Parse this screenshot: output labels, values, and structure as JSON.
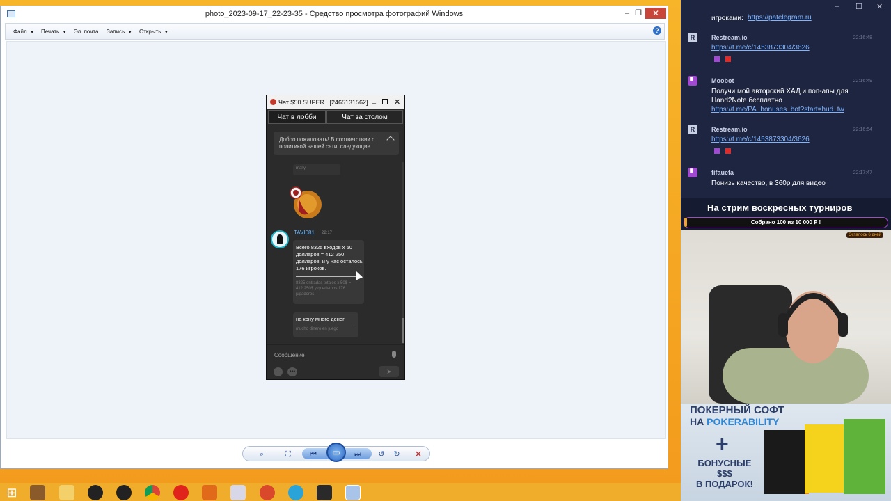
{
  "viewer": {
    "title": "photo_2023-09-17_22-23-35 - Средство просмотра фотографий Windows",
    "menu": [
      "Файл",
      "Печать",
      "Эл. почта",
      "Запись",
      "Открыть"
    ],
    "help": "?",
    "close_glyph": "✕",
    "max_glyph": "❐",
    "min_glyph": "–"
  },
  "chat": {
    "title": "Чат $50 SUPER..  [2465131562]",
    "tabs": [
      "Чат в лобби",
      "Чат за столом"
    ],
    "welcome": "Добро пожаловать! В соответствии с политикой нашей сети, следующие",
    "prev_user": "mally",
    "username": "TAVI081",
    "time": "22:17",
    "msg1": "Всего 8325 входов х 50 долларов = 412 250 долларов, и у нас осталось 176 игроков.",
    "msg1_trans": "8325 entradas totales x 50$ = 412,250$ y quedamos 176 jugadores",
    "msg2": "на кону много денег",
    "msg2_trans": "mucho dinero en juego",
    "compose_placeholder": "Сообщение"
  },
  "stream": {
    "messages": [
      {
        "name": "",
        "time": "",
        "text": "игроками: ",
        "link": "https://patelegram.ru"
      },
      {
        "name": "Restream.io",
        "time": "22:16:48",
        "text": "",
        "link": "https://t.me/c/1453873304/3626"
      },
      {
        "name": "Moobot",
        "time": "22:16:49",
        "text": "Получи мой авторский ХАД и поп-апы для Hand2Note бесплатно",
        "link": "https://t.me/PA_bonuses_bot?start=hud_tw"
      },
      {
        "name": "Restream.io",
        "time": "22:16:54",
        "text": "",
        "link": "https://t.me/c/1453873304/3626"
      },
      {
        "name": "fifauefa",
        "time": "22:17:47",
        "text": "Понизь качество, в 360p для видео",
        "link": ""
      }
    ],
    "banner": "На стрим воскресных турниров",
    "goal_text": "Собрано 100  из 10 000 ₽ !",
    "goal_progress": 0.01,
    "goal_left": "Осталось 6 дней",
    "ad_line1": "ПОКЕРНЫЙ СОФТ",
    "ad_line2a": "НА ",
    "ad_line2b": "POKERABILITY",
    "ad_plus": "+",
    "ad_line3": "БОНУСНЫЕ\n$$$\nВ ПОДАРОК!"
  },
  "colors": {
    "accent": "#f0a520",
    "twitch": "#a04ad2",
    "link": "#7fb4ff"
  }
}
